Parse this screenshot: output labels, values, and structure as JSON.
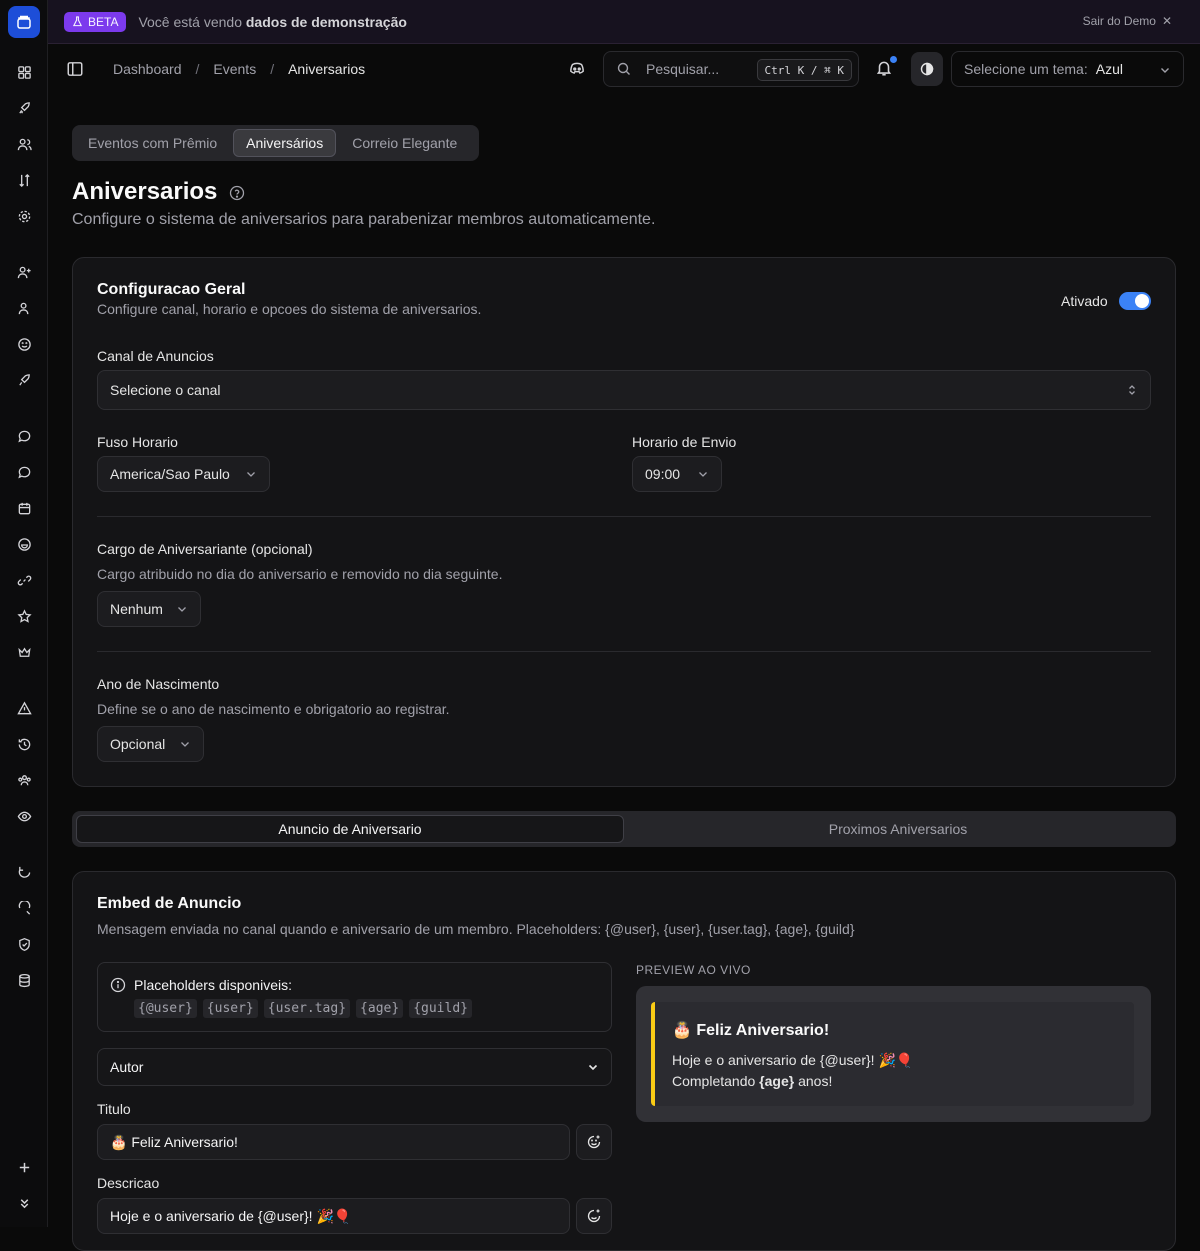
{
  "banner": {
    "badge": "BETA",
    "text_prefix": "Você está vendo",
    "text_bold": "dados de demonstração",
    "exit_label": "Sair do Demo"
  },
  "breadcrumb": [
    "Dashboard",
    "/",
    "Events",
    "/",
    "Aniversarios"
  ],
  "search": {
    "placeholder": "Pesquisar...",
    "shortcut": "Ctrl K / ⌘ K"
  },
  "theme": {
    "label": "Selecione um tema:",
    "value": "Azul"
  },
  "tabs": [
    "Eventos com Prêmio",
    "Aniversários",
    "Correio Elegante"
  ],
  "page": {
    "title": "Aniversarios",
    "subtitle": "Configure o sistema de aniversarios para parabenizar membros automaticamente."
  },
  "general": {
    "title": "Configuracao Geral",
    "subtitle": "Configure canal, horario e opcoes do sistema de aniversarios.",
    "toggle_label": "Ativado",
    "toggle_on": true,
    "channel_label": "Canal de Anuncios",
    "channel_value": "Selecione o canal",
    "timezone_label": "Fuso Horario",
    "timezone_value": "America/Sao Paulo",
    "time_label": "Horario de Envio",
    "time_value": "09:00",
    "role_label": "Cargo de Aniversariante (opcional)",
    "role_hint": "Cargo atribuido no dia do aniversario e removido no dia seguinte.",
    "role_value": "Nenhum",
    "year_label": "Ano de Nascimento",
    "year_hint": "Define se o ano de nascimento e obrigatorio ao registrar.",
    "year_value": "Opcional"
  },
  "segment": [
    "Anuncio de Aniversario",
    "Proximos Aniversarios"
  ],
  "embed": {
    "title": "Embed de Anuncio",
    "subtitle": "Mensagem enviada no canal quando e aniversario de um membro. Placeholders: {@user}, {user}, {user.tag}, {age}, {guild}",
    "placeholders_title": "Placeholders disponiveis:",
    "placeholders": [
      "{@user}",
      "{user}",
      "{user.tag}",
      "{age}",
      "{guild}"
    ],
    "author_label": "Autor",
    "title_label": "Titulo",
    "title_value": "🎂 Feliz Aniversario!",
    "desc_label": "Descricao",
    "desc_value": "Hoje e o aniversario de {@user}! 🎉🎈"
  },
  "preview": {
    "label": "PREVIEW AO VIVO",
    "title": "🎂 Feliz Aniversario!",
    "line1": "Hoje e o aniversario de {@user}! 🎉🎈",
    "line2_prefix": "Completando",
    "line2_bold": "{age}",
    "line2_suffix": "anos!"
  },
  "colors": {
    "accent": "#3b82f6",
    "beta": "#7c3aed",
    "embed_border": "#facc15"
  },
  "icons": [
    "dashboard-icon",
    "rocket-icon",
    "users-icon",
    "sort-icon",
    "gear-icon",
    "user-plus-icon",
    "user-icon",
    "smile-icon",
    "rocket-icon",
    "message-icon",
    "message-icon",
    "calendar-icon",
    "smile-icon",
    "link-icon",
    "star-icon",
    "crown-icon",
    "warning-icon",
    "history-icon",
    "group-icon",
    "eye-icon",
    "refresh-icon",
    "search-refresh-icon",
    "shield-icon",
    "database-icon",
    "plus-icon",
    "chevrons-down-icon"
  ]
}
